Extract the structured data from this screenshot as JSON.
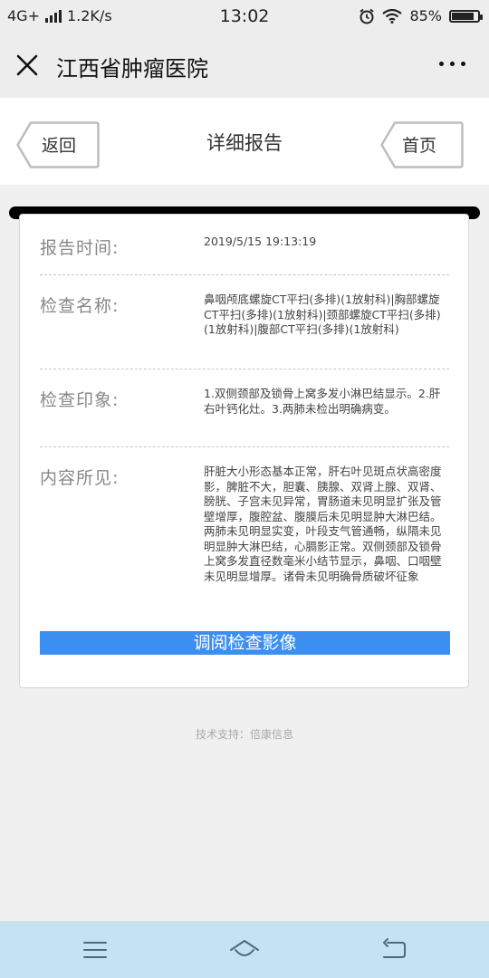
{
  "status_bar": {
    "network": "4G+",
    "speed": "1.2K/s",
    "time": "13:02",
    "battery": "85%",
    "battery_level": 0.85
  },
  "title_bar": {
    "title": "江西省肿瘤医院"
  },
  "sub_header": {
    "back_label": "返回",
    "heading": "详细报告",
    "home_label": "首页"
  },
  "report": {
    "fields": [
      {
        "label": "报告时间:",
        "value": "2019/5/15 19:13:19"
      },
      {
        "label": "检查名称:",
        "value": "鼻咽颅底螺旋CT平扫(多排)(1放射科)|胸部螺旋CT平扫(多排)(1放射科)|颈部螺旋CT平扫(多排)(1放射科)|腹部CT平扫(多排)(1放射科)"
      },
      {
        "label": "检查印象:",
        "value": "1.双侧颈部及锁骨上窝多发小淋巴结显示。2.肝右叶钙化灶。3.两肺未检出明确病变。"
      },
      {
        "label": "内容所见:",
        "value": "肝脏大小形态基本正常，肝右叶见斑点状高密度影，脾脏不大，胆囊、胰腺、双肾上腺、双肾、膀胱、子宫未见异常，胃肠道未见明显扩张及管壁增厚，腹腔盆、腹膜后未见明显肿大淋巴结。两肺未见明显实变，叶段支气管通畅，纵隔未见明显肿大淋巴结，心膈影正常。双侧颈部及锁骨上窝多发直径数毫米小结节显示，鼻咽、口咽壁未见明显增厚。诸骨未见明确骨质破坏征象"
      }
    ],
    "view_images_button": "调阅检查影像"
  },
  "footer": {
    "text": "技术支持：倍康信息"
  },
  "bottom_nav": {
    "icons": [
      "menu-icon",
      "home-icon",
      "back-icon"
    ]
  }
}
